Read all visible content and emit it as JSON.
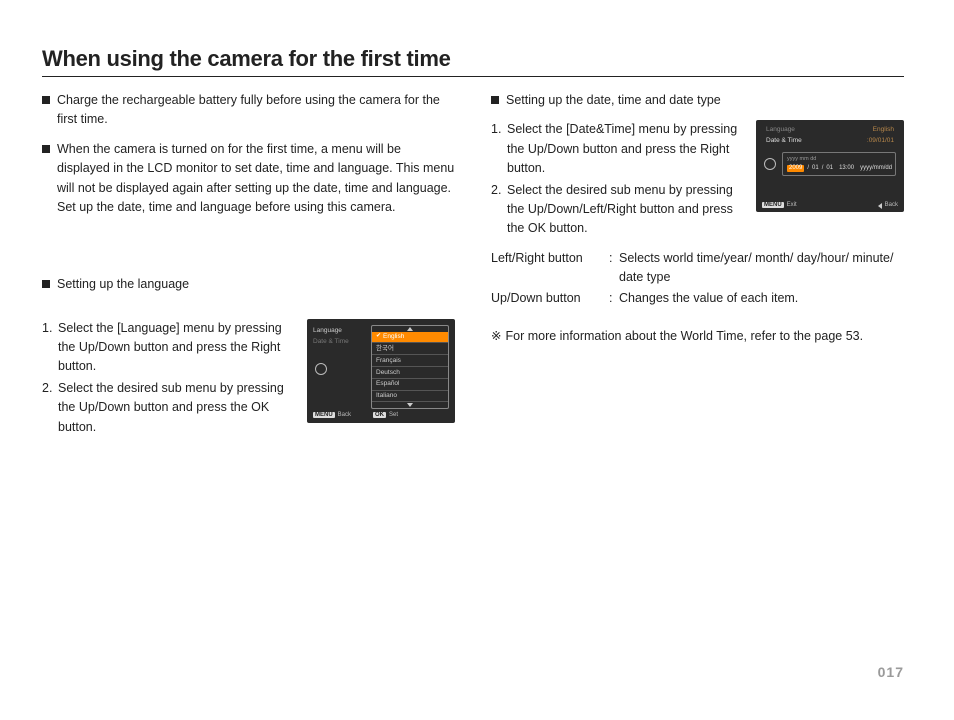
{
  "title": "When using the camera for the first time",
  "page_number": "017",
  "left": {
    "bullets": [
      "Charge the rechargeable battery fully before using the camera for the first time.",
      "When the camera is turned on for the first time, a menu will be displayed in the LCD monitor to set date, time and language. This menu will not be displayed again after setting up the date, time and language. Set up the date, time and language before using this camera."
    ],
    "section_heading": "Setting up the language",
    "steps": [
      "Select the [Language] menu by pressing the Up/Down button and press the Right button.",
      "Select the desired sub menu by pressing the Up/Down button and press the OK button."
    ]
  },
  "right": {
    "section_heading": "Setting up the date, time and date type",
    "steps": [
      "Select the [Date&Time] menu by pressing the Up/Down button and press the Right button.",
      "Select the desired sub menu by pressing the Up/Down/Left/Right button and press the OK button."
    ],
    "defs": [
      {
        "label": "Left/Right button",
        "value": "Selects world time/year/ month/ day/hour/ minute/ date type"
      },
      {
        "label": "Up/Down button",
        "value": "Changes the value of each item."
      }
    ],
    "note_symbol": "※",
    "note": "For more information about the World Time, refer to the page 53."
  },
  "lcd_lang": {
    "menu_language": "Language",
    "menu_datetime": "Date & Time",
    "options": [
      "English",
      "한국어",
      "Français",
      "Deutsch",
      "Español",
      "Italiano"
    ],
    "btn_back_tag": "MENU",
    "btn_back": "Back",
    "btn_set_tag": "OK",
    "btn_set": "Set"
  },
  "lcd_date": {
    "row_language_label": "Language",
    "row_language_value": "English",
    "row_datetime_label": "Date & Time",
    "row_datetime_value": ":09/01/01",
    "header": "yyyy mm dd",
    "year": "2009",
    "sep": "/",
    "mm": "01",
    "dd": "01",
    "time": "13:00",
    "fmt": "yyyy/mm/dd",
    "btn_exit_tag": "MENU",
    "btn_exit": "Exit",
    "btn_back": "Back"
  }
}
